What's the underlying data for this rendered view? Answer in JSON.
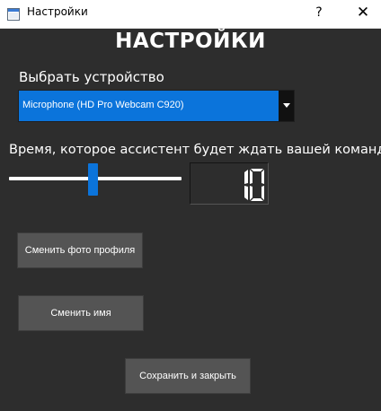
{
  "window": {
    "title": "Настройки",
    "help_label": "?",
    "close_label": "✕"
  },
  "heading": "НАСТРОЙКИ",
  "device": {
    "label": "Выбрать устройство",
    "selected": "Microphone (HD Pro Webcam C920)"
  },
  "wait": {
    "label": "Время, которое ассистент будет ждать вашей команды",
    "value": 10,
    "value_text": "10",
    "slider_fraction": 0.5
  },
  "buttons": {
    "change_photo": "Сменить фото профиля",
    "change_name": "Сменить имя",
    "save_close": "Сохранить и закрыть"
  },
  "colors": {
    "background": "#2d2d2d",
    "accent": "#0b74db",
    "button": "#545454",
    "text": "#ffffff"
  },
  "icons": {
    "app": "window-icon",
    "dropdown": "chevron-down-icon"
  }
}
